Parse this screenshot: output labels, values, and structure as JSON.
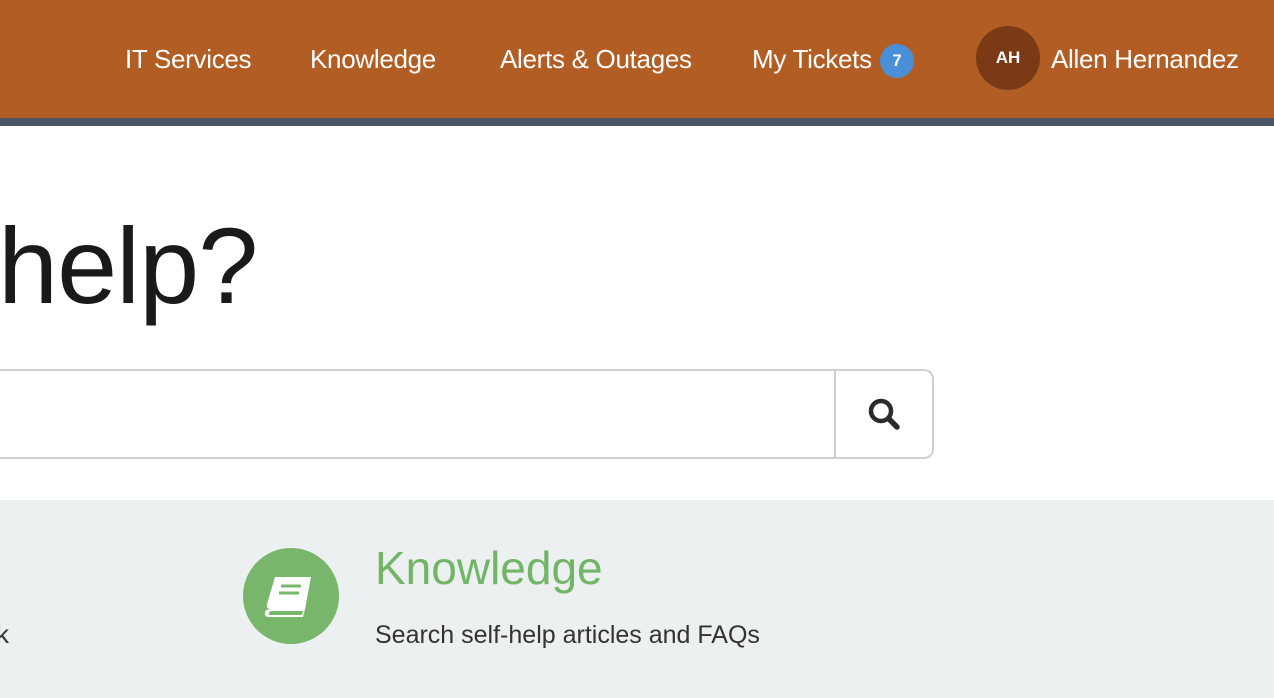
{
  "header": {
    "nav": [
      "IT Services",
      "Knowledge",
      "Alerts & Outages",
      "My Tickets"
    ],
    "tickets_badge": "7",
    "user": {
      "initials": "AH",
      "name": "Allen Hernandez"
    },
    "colors": {
      "bar": "#b25d23",
      "stripe": "#4a5568",
      "badge": "#4a90d9",
      "avatar": "#7b3a15"
    }
  },
  "hero": {
    "title": "help?"
  },
  "search": {
    "placeholder": "",
    "button_icon": "search-icon"
  },
  "cards": {
    "left_fragment": "k",
    "knowledge": {
      "icon": "book-icon",
      "title": "Knowledge",
      "description": "Search self-help articles and FAQs",
      "color": "#78b66b"
    }
  }
}
